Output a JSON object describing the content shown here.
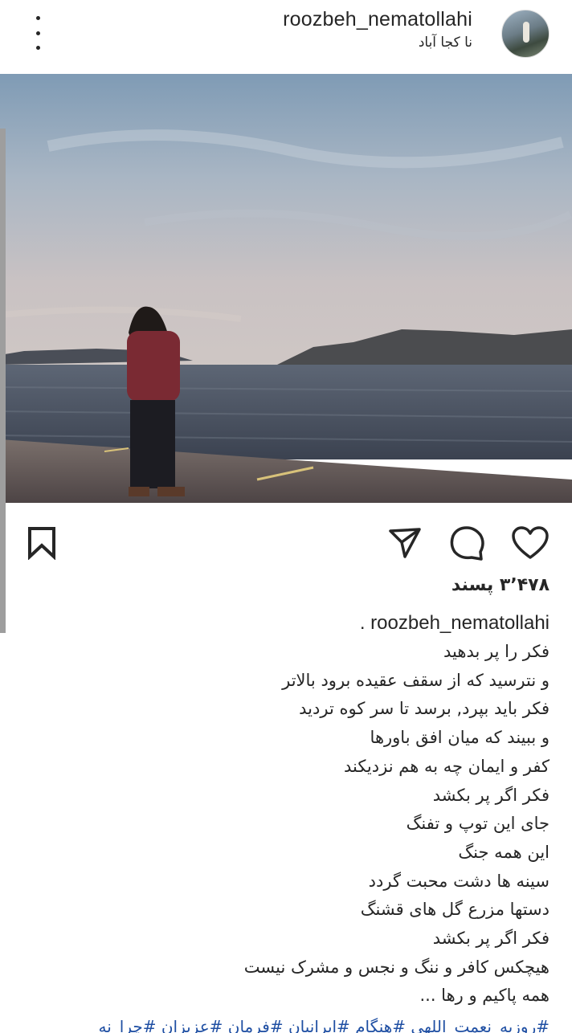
{
  "header": {
    "username": "roozbeh_nematollahi",
    "location": "نا کجا آباد"
  },
  "post": {
    "likes": "۳٬۴۷۸ پسند",
    "caption_username": ". roozbeh_nematollahi",
    "caption_lines": [
      "فکر را پر بدهید",
      "و نترسید که از سقف عقیده برود بالاتر",
      "فکر باید بپرد, برسد تا سر کوه تردید",
      "و ببیند که میان افق باورها",
      "کفر و ایمان چه به هم نزدیکند",
      "فکر اگر پر بکشد",
      "جای این توپ و تفنگ",
      "این همه جنگ",
      "سینه ها دشت محبت گردد",
      "دستها مزرع گل های قشنگ",
      "فکر اگر پر بکشد",
      "هیچکس کافر و ننگ و نجس و مشرک نیست",
      "همه پاکیم و رها ..."
    ],
    "hashtags": "#روزبه_نعمت_اللهی #هنگام #ایرانیان #فرمان #عزیزان #چرا_نه"
  },
  "icons": {
    "more": "more-options-icon",
    "bookmark": "bookmark-icon",
    "share": "send-icon",
    "comment": "comment-icon",
    "like": "heart-icon"
  }
}
